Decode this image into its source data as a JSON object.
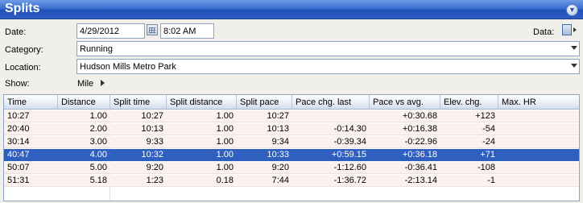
{
  "title": "Splits",
  "form": {
    "date_label": "Date:",
    "date_value": "4/29/2012",
    "time_value": "8:02 AM",
    "data_label": "Data:",
    "category_label": "Category:",
    "category_value": "Running",
    "location_label": "Location:",
    "location_value": "Hudson Mills Metro Park",
    "show_label": "Show:",
    "show_value": "Mile"
  },
  "table": {
    "columns": [
      "Time",
      "Distance",
      "Split time",
      "Split distance",
      "Split pace",
      "Pace chg. last",
      "Pace vs avg.",
      "Elev. chg.",
      "Max. HR"
    ],
    "selected_row": 3,
    "rows": [
      [
        "10:27",
        "1.00",
        "10:27",
        "1.00",
        "10:27",
        "",
        "+0:30.68",
        "+123",
        ""
      ],
      [
        "20:40",
        "2.00",
        "10:13",
        "1.00",
        "10:13",
        "-0:14.30",
        "+0:16.38",
        "-54",
        ""
      ],
      [
        "30:14",
        "3.00",
        "9:33",
        "1.00",
        "9:34",
        "-0:39.34",
        "-0:22.96",
        "-24",
        ""
      ],
      [
        "40:47",
        "4.00",
        "10:32",
        "1.00",
        "10:33",
        "+0:59.15",
        "+0:36.18",
        "+71",
        ""
      ],
      [
        "50:07",
        "5.00",
        "9:20",
        "1.00",
        "9:20",
        "-1:12.60",
        "-0:36.41",
        "-108",
        ""
      ],
      [
        "51:31",
        "5.18",
        "1:23",
        "0.18",
        "7:44",
        "-1:36.72",
        "-2:13.14",
        "-1",
        ""
      ]
    ]
  }
}
